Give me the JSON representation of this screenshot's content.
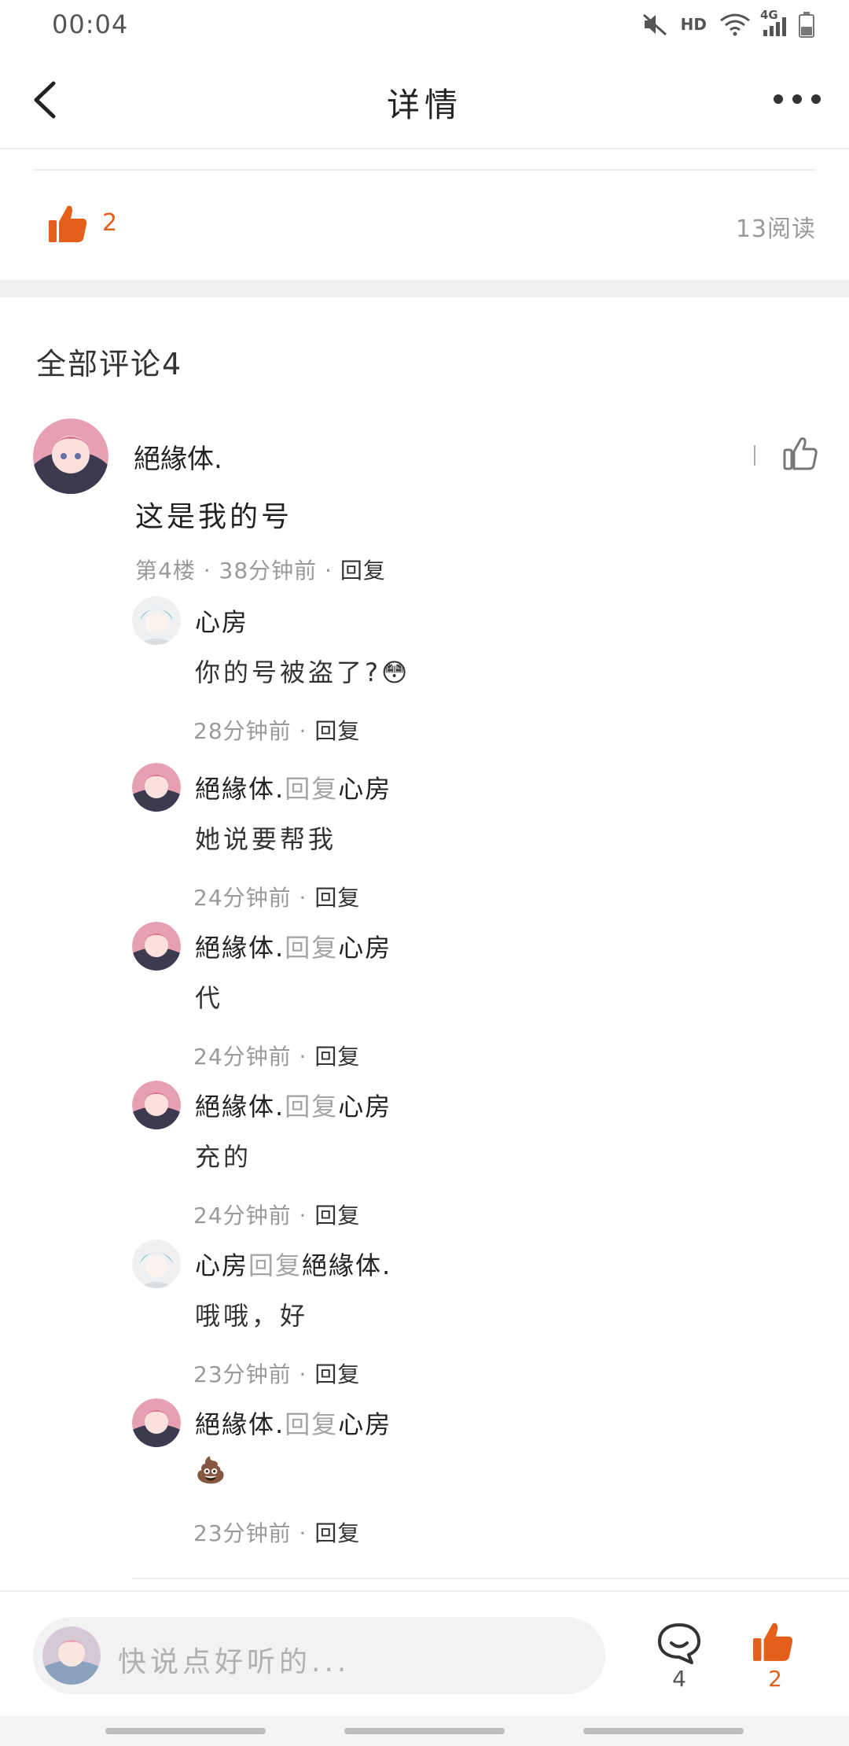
{
  "status_bar": {
    "time": "00:04",
    "hd": "HD",
    "network": "4G"
  },
  "header": {
    "title": "详情"
  },
  "post": {
    "like_count": "2",
    "read_count": "13阅读"
  },
  "comments": {
    "title": "全部评论4",
    "main": {
      "author": "絕緣体.",
      "text": "这是我的号",
      "meta": "第4楼 · 38分钟前 · ",
      "reply_label": "回复",
      "replies": [
        {
          "author": "心房",
          "mid": "",
          "target": "",
          "text": "你的号被盗了?😳",
          "time": "28分钟前 · ",
          "reply_label": "回复",
          "avatar": "blue"
        },
        {
          "author": "絕緣体.",
          "mid": "回复",
          "target": "心房",
          "text": "她说要帮我",
          "time": "24分钟前 · ",
          "reply_label": "回复",
          "avatar": "pink"
        },
        {
          "author": "絕緣体.",
          "mid": "回复",
          "target": "心房",
          "text": "代",
          "time": "24分钟前 · ",
          "reply_label": "回复",
          "avatar": "pink"
        },
        {
          "author": "絕緣体.",
          "mid": "回复",
          "target": "心房",
          "text": "充的",
          "time": "24分钟前 · ",
          "reply_label": "回复",
          "avatar": "pink"
        },
        {
          "author": "心房",
          "mid": "回复",
          "target": "絕緣体.",
          "text": "哦哦，好",
          "time": "23分钟前 · ",
          "reply_label": "回复",
          "avatar": "blue"
        },
        {
          "author": "絕緣体.",
          "mid": "回复",
          "target": "心房",
          "text": "💩",
          "time": "23分钟前 · ",
          "reply_label": "回复",
          "avatar": "pink"
        }
      ]
    }
  },
  "bottom_bar": {
    "placeholder": "快说点好听的...",
    "comment_count": "4",
    "like_count": "2"
  },
  "colors": {
    "accent": "#e4601a",
    "text": "#222222",
    "meta": "#9a9a9a"
  }
}
